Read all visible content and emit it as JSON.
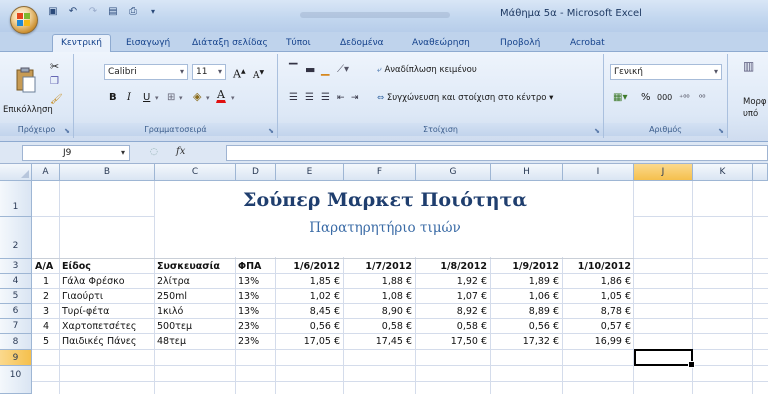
{
  "window": {
    "title": "Μάθημα 5α - Microsoft Excel"
  },
  "ribbon": {
    "tabs": [
      "Κεντρική",
      "Εισαγωγή",
      "Διάταξη σελίδας",
      "Τύποι",
      "Δεδομένα",
      "Αναθεώρηση",
      "Προβολή",
      "Acrobat"
    ],
    "active_tab": "Κεντρική",
    "clipboard": {
      "paste_label": "Επικόλληση",
      "group_label": "Πρόχειρο"
    },
    "font": {
      "name": "Calibri",
      "size": "11",
      "grow": "A",
      "shrink": "A",
      "bold": "B",
      "italic": "I",
      "underline": "U",
      "font_color_letter": "A",
      "group_label": "Γραμματοσειρά"
    },
    "alignment": {
      "wrap_text": "Αναδίπλωση κειμένου",
      "merge_center": "Συγχώνευση και στοίχιση στο κέντρο",
      "group_label": "Στοίχιση"
    },
    "number": {
      "format": "Γενική",
      "percent": "%",
      "thousands": "000",
      "group_label": "Αριθμός"
    },
    "styles": {
      "partial_label_1": "Μορφ",
      "partial_label_2": "υπό"
    }
  },
  "formula_bar": {
    "name_box": "J9",
    "fx": "fx",
    "formula": ""
  },
  "sheet": {
    "columns": [
      "A",
      "B",
      "C",
      "D",
      "E",
      "F",
      "G",
      "H",
      "I",
      "J",
      "K"
    ],
    "rows": [
      "1",
      "2",
      "3",
      "4",
      "5",
      "6",
      "7",
      "8",
      "9",
      "10"
    ],
    "selected_column": "J",
    "selected_row": "9",
    "title": "Σούπερ Μαρκετ Ποιότητα",
    "subtitle": "Παρατηρητήριο τιμών",
    "headers": [
      "Α/Α",
      "Είδος",
      "Συσκευασία",
      "ΦΠΑ",
      "1/6/2012",
      "1/7/2012",
      "1/8/2012",
      "1/9/2012",
      "1/10/2012"
    ],
    "data": [
      [
        "1",
        "Γάλα Φρέσκο",
        "2λίτρα",
        "13%",
        "1,85 €",
        "1,88 €",
        "1,92 €",
        "1,89 €",
        "1,86 €"
      ],
      [
        "2",
        "Γιαούρτι",
        "250ml",
        "13%",
        "1,02 €",
        "1,08 €",
        "1,07 €",
        "1,06 €",
        "1,05 €"
      ],
      [
        "3",
        "Τυρί-φέτα",
        "1κιλό",
        "13%",
        "8,45 €",
        "8,90 €",
        "8,92 €",
        "8,89 €",
        "8,78 €"
      ],
      [
        "4",
        "Χαρτοπετσέτες",
        "500τεμ",
        "23%",
        "0,56 €",
        "0,58 €",
        "0,58 €",
        "0,56 €",
        "0,57 €"
      ],
      [
        "5",
        "Παιδικές Πάνες",
        "48τεμ",
        "23%",
        "17,05 €",
        "17,45 €",
        "17,50 €",
        "17,32 €",
        "16,99 €"
      ]
    ]
  }
}
